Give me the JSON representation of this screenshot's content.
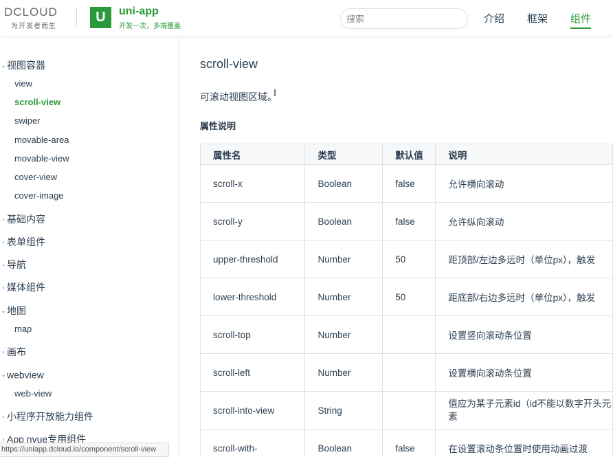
{
  "header": {
    "dcloud_logo": "DCLOUD",
    "dcloud_tagline": "为开发者而生",
    "uni_logo_glyph": "U",
    "uni_title": "uni-app",
    "uni_subtitle": "开发一次，多端覆盖",
    "search_placeholder": "搜索",
    "nav": [
      "介绍",
      "框架",
      "组件"
    ],
    "active_nav": "组件",
    "accent_color": "#2b9939"
  },
  "sidebar": {
    "groups": [
      {
        "label": "视图容器",
        "expanded": true,
        "items": [
          "view",
          "scroll-view",
          "swiper",
          "movable-area",
          "movable-view",
          "cover-view",
          "cover-image"
        ]
      },
      {
        "label": "基础内容",
        "expanded": false
      },
      {
        "label": "表单组件",
        "expanded": false
      },
      {
        "label": "导航",
        "expanded": false
      },
      {
        "label": "媒体组件",
        "expanded": false
      },
      {
        "label": "地图",
        "expanded": true,
        "items": [
          "map"
        ]
      },
      {
        "label": "画布",
        "expanded": false
      },
      {
        "label": "webview",
        "expanded": true,
        "items": [
          "web-view"
        ]
      },
      {
        "label": "小程序开放能力组件",
        "expanded": false
      },
      {
        "label": "App nvue专用组件",
        "expanded": false
      }
    ],
    "active_item": "scroll-view",
    "status_url": "https://uniapp.dcloud.io/component/scroll-view"
  },
  "content": {
    "title": "scroll-view",
    "description": "可滚动视图区域。",
    "section_title": "属性说明",
    "table": {
      "headers": [
        "属性名",
        "类型",
        "默认值",
        "说明"
      ],
      "rows": [
        [
          "scroll-x",
          "Boolean",
          "false",
          "允许横向滚动"
        ],
        [
          "scroll-y",
          "Boolean",
          "false",
          "允许纵向滚动"
        ],
        [
          "upper-threshold",
          "Number",
          "50",
          "距顶部/左边多远时（单位px），触发"
        ],
        [
          "lower-threshold",
          "Number",
          "50",
          "距底部/右边多远时（单位px），触发"
        ],
        [
          "scroll-top",
          "Number",
          "",
          "设置竖向滚动条位置"
        ],
        [
          "scroll-left",
          "Number",
          "",
          "设置横向滚动条位置"
        ],
        [
          "scroll-into-view",
          "String",
          "",
          "值应为某子元素id（id不能以数字开头元素"
        ],
        [
          "scroll-with-",
          "Boolean",
          "false",
          "在设置滚动条位置时使用动画过渡"
        ]
      ]
    }
  }
}
